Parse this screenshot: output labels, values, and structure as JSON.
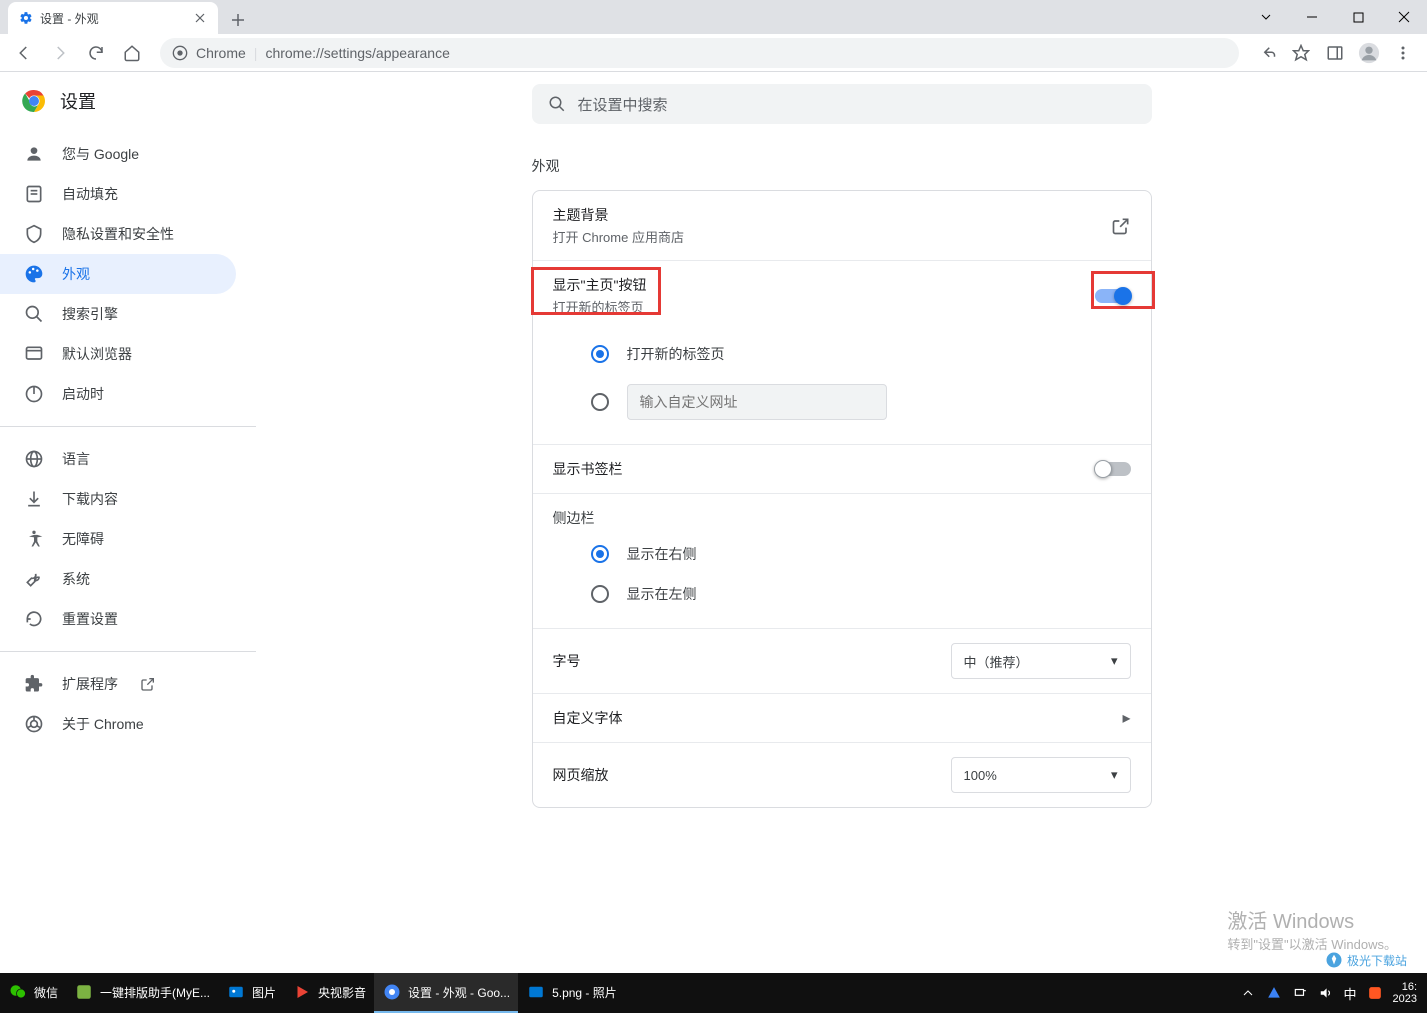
{
  "window": {
    "tab_title": "设置 - 外观",
    "minimize_dash": "—"
  },
  "toolbar": {
    "chrome_label": "Chrome",
    "url": "chrome://settings/appearance"
  },
  "sidebar": {
    "app_title": "设置",
    "items": [
      {
        "icon": "person-icon",
        "label": "您与 Google"
      },
      {
        "icon": "autofill-icon",
        "label": "自动填充"
      },
      {
        "icon": "shield-icon",
        "label": "隐私设置和安全性"
      },
      {
        "icon": "palette-icon",
        "label": "外观"
      },
      {
        "icon": "search-icon",
        "label": "搜索引擎"
      },
      {
        "icon": "browser-icon",
        "label": "默认浏览器"
      },
      {
        "icon": "power-icon",
        "label": "启动时"
      }
    ],
    "items2": [
      {
        "icon": "globe-icon",
        "label": "语言"
      },
      {
        "icon": "download-icon",
        "label": "下载内容"
      },
      {
        "icon": "accessibility-icon",
        "label": "无障碍"
      },
      {
        "icon": "wrench-icon",
        "label": "系统"
      },
      {
        "icon": "reset-icon",
        "label": "重置设置"
      }
    ],
    "items3": [
      {
        "icon": "extension-icon",
        "label": "扩展程序",
        "external": true
      },
      {
        "icon": "chrome-icon",
        "label": "关于 Chrome"
      }
    ]
  },
  "main": {
    "search_placeholder": "在设置中搜索",
    "section_title": "外观",
    "theme": {
      "title": "主题背景",
      "sub": "打开 Chrome 应用商店"
    },
    "home_button": {
      "title": "显示\"主页\"按钮",
      "sub": "打开新的标签页"
    },
    "home_options": {
      "new_tab": "打开新的标签页",
      "custom_placeholder": "输入自定义网址"
    },
    "bookmarks_bar": "显示书签栏",
    "sidebar_label": "侧边栏",
    "sidebar_options": {
      "right": "显示在右侧",
      "left": "显示在左侧"
    },
    "font_size": {
      "label": "字号",
      "value": "中（推荐）"
    },
    "custom_font": "自定义字体",
    "page_zoom": {
      "label": "网页缩放",
      "value": "100%"
    }
  },
  "watermark": {
    "title": "激活 Windows",
    "sub": "转到\"设置\"以激活 Windows。"
  },
  "brand_wm": "极光下载站",
  "taskbar": {
    "items": [
      {
        "icon": "wechat",
        "label": "微信",
        "color": "#2dc100"
      },
      {
        "icon": "app",
        "label": "一键排版助手(MyE...",
        "color": "#7cb342"
      },
      {
        "icon": "photos",
        "label": "图片",
        "color": "#0078d4"
      },
      {
        "icon": "play",
        "label": "央视影音",
        "color": "#ff5722"
      },
      {
        "icon": "chrome",
        "label": "设置 - 外观 - Goo...",
        "color": "#4285f4",
        "active": true
      },
      {
        "icon": "photos",
        "label": "5.png - 照片",
        "color": "#0078d4"
      }
    ],
    "ime": "中",
    "time": "16:",
    "date": "2023"
  }
}
